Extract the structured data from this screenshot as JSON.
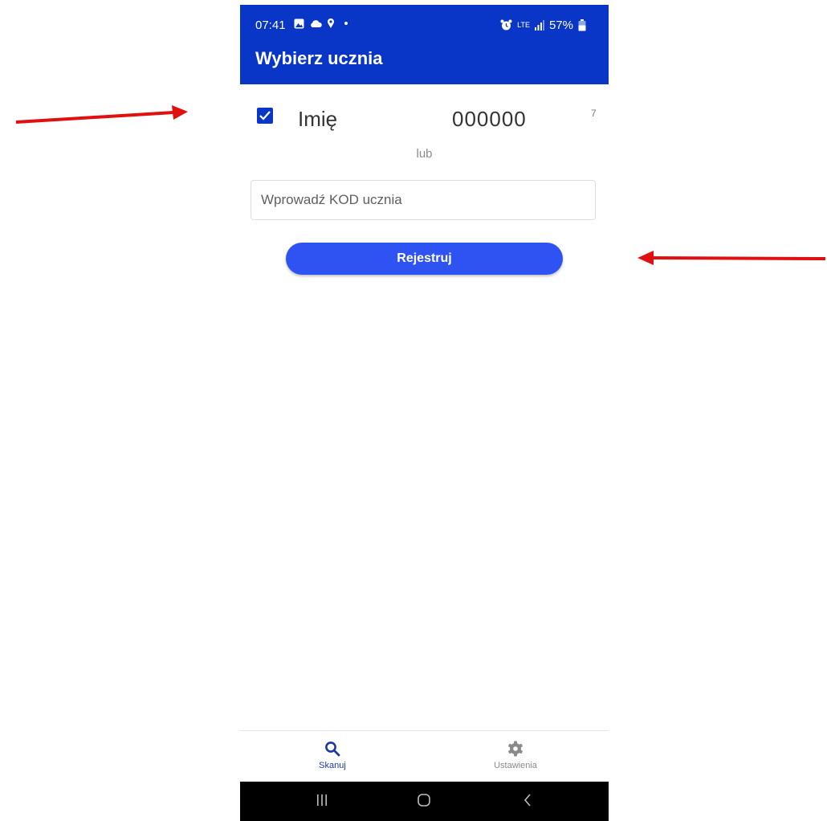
{
  "status_bar": {
    "time": "07:41",
    "network": "LTE",
    "battery": "57%"
  },
  "app_bar": {
    "title": "Wybierz ucznia"
  },
  "student_row": {
    "name": "Imię",
    "code": "000000",
    "suffix": "7",
    "checked": true
  },
  "or_label": "lub",
  "code_input": {
    "value": "",
    "placeholder": "Wprowadź KOD ucznia"
  },
  "register_button": {
    "label": "Rejestruj"
  },
  "bottom_nav": {
    "items": [
      {
        "label": "Skanuj",
        "icon": "search-icon",
        "active": true
      },
      {
        "label": "Ustawienia",
        "icon": "gear-icon",
        "active": false
      }
    ]
  },
  "colors": {
    "primary": "#0a36c7",
    "button": "#2f53f3",
    "annotation_arrow": "#e01010"
  }
}
